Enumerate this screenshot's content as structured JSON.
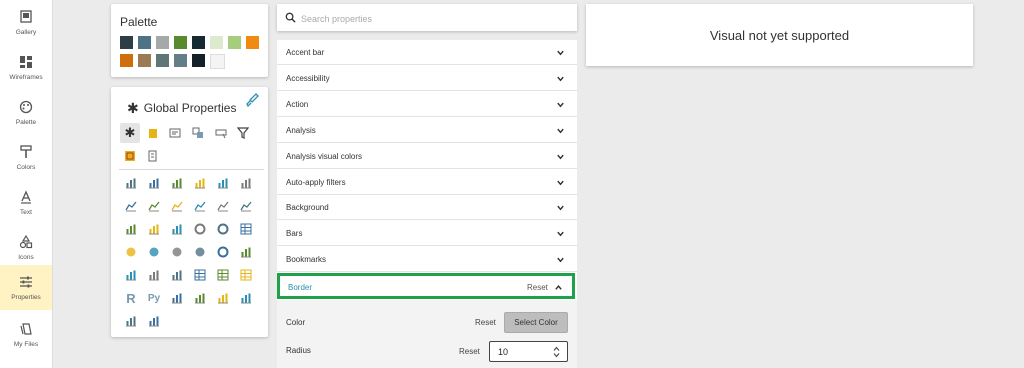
{
  "nav": {
    "items": [
      {
        "label": "Gallery",
        "icon": "gallery-icon"
      },
      {
        "label": "Wireframes",
        "icon": "wireframes-icon"
      },
      {
        "label": "Palette",
        "icon": "palette-icon"
      },
      {
        "label": "Colors",
        "icon": "paint-roller-icon"
      },
      {
        "label": "Text",
        "icon": "text-icon"
      },
      {
        "label": "Icons",
        "icon": "shapes-icon"
      },
      {
        "label": "Properties",
        "icon": "sliders-icon"
      },
      {
        "label": "My Files",
        "icon": "files-icon"
      }
    ],
    "active": "Properties"
  },
  "palette": {
    "title": "Palette",
    "colors_row1": [
      "#2d3e47",
      "#4d7384",
      "#a5a9a9",
      "#598a2e",
      "#172a31",
      "#dcebd0",
      "#a6cc7e",
      "#f08a10"
    ],
    "colors_row2": [
      "#d06e0c",
      "#9c7a53",
      "#5f7677",
      "#637e86",
      "#142128",
      "#f4f4f4"
    ]
  },
  "global_properties": {
    "title": "Global Properties",
    "star": "✱",
    "brush_icon": "paint-brush-icon"
  },
  "search": {
    "placeholder": "Search properties"
  },
  "properties": {
    "sections": [
      "Accent bar",
      "Accessibility",
      "Action",
      "Analysis",
      "Analysis visual colors",
      "Auto-apply filters",
      "Background",
      "Bars",
      "Bookmarks"
    ],
    "expanded": {
      "label": "Border",
      "reset": "Reset",
      "color_label": "Color",
      "color_reset": "Reset",
      "select_color": "Select Color",
      "radius_label": "Radius",
      "radius_reset": "Reset",
      "radius_value": "10"
    }
  },
  "visual": {
    "message": "Visual not yet supported"
  },
  "colors": {
    "accent_green": "#1fa149",
    "active_nav_bg": "#fff3c4",
    "link_blue": "#2a8fb0"
  }
}
